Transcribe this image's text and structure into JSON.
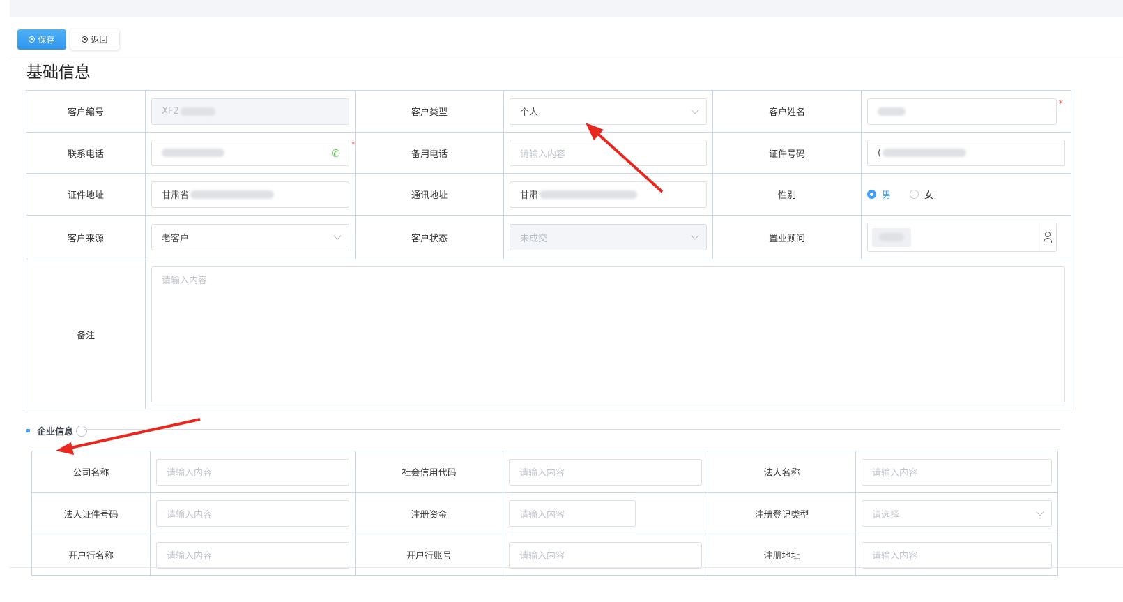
{
  "toolbar": {
    "save_label": "保存",
    "back_label": "返回"
  },
  "section_title": "基础信息",
  "basic": {
    "customer_no_label": "客户编号",
    "customer_no_value": "XF2",
    "customer_type_label": "客户类型",
    "customer_type_value": "个人",
    "customer_name_label": "客户姓名",
    "phone_label": "联系电话",
    "backup_phone_label": "备用电话",
    "backup_phone_placeholder": "请输入内容",
    "id_no_label": "证件号码",
    "id_no_value": "(",
    "id_address_label": "证件地址",
    "id_address_value": "甘肃省",
    "mail_address_label": "通讯地址",
    "mail_address_value": "甘肃",
    "gender_label": "性别",
    "gender_male": "男",
    "gender_female": "女",
    "gender_selected": "男",
    "source_label": "客户来源",
    "source_value": "老客户",
    "status_label": "客户状态",
    "status_value": "未成交",
    "advisor_label": "置业顾问",
    "remark_label": "备注",
    "remark_placeholder": "请输入内容",
    "required_mark": "*"
  },
  "enterprise": {
    "title": "企业信息",
    "company_name_label": "公司名称",
    "credit_code_label": "社会信用代码",
    "legal_name_label": "法人名称",
    "legal_id_label": "法人证件号码",
    "reg_capital_label": "注册资金",
    "reg_type_label": "注册登记类型",
    "reg_type_placeholder": "请选择",
    "bank_name_label": "开户行名称",
    "bank_account_label": "开户行账号",
    "reg_address_label": "注册地址",
    "placeholder": "请输入内容"
  },
  "colors": {
    "primary": "#409eff",
    "required": "#f56c6c",
    "arrow": "#e8281f",
    "phone_icon": "#5ac34a"
  }
}
